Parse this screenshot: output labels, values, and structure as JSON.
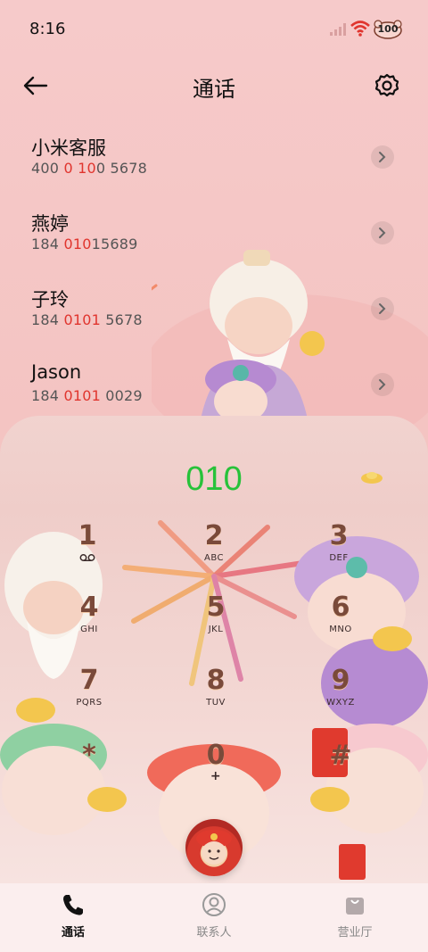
{
  "status": {
    "time": "8:16",
    "battery": "100",
    "icons": [
      "signal-icon",
      "wifi-icon",
      "battery-icon"
    ]
  },
  "header": {
    "title": "通话",
    "back_icon": "back-arrow-icon",
    "settings_icon": "gear-icon"
  },
  "recents": [
    {
      "name": "小米客服",
      "num_pre": "400 ",
      "num_hl": "0 10",
      "num_post": "0 5678"
    },
    {
      "name": "燕婷",
      "num_pre": "184 ",
      "num_hl": "010",
      "num_post": "15689"
    },
    {
      "name": "子玲",
      "num_pre": "184 ",
      "num_hl": "0101",
      "num_post": " 5678"
    },
    {
      "name": "Jason",
      "num_pre": "184 ",
      "num_hl": "0101",
      "num_post": " 0029"
    }
  ],
  "dialer": {
    "typed": "010",
    "keys": [
      {
        "digit": "1",
        "letters": "voicemail"
      },
      {
        "digit": "2",
        "letters": "ABC"
      },
      {
        "digit": "3",
        "letters": "DEF"
      },
      {
        "digit": "4",
        "letters": "GHI"
      },
      {
        "digit": "5",
        "letters": "JKL"
      },
      {
        "digit": "6",
        "letters": "MNO"
      },
      {
        "digit": "7",
        "letters": "PQRS"
      },
      {
        "digit": "8",
        "letters": "TUV"
      },
      {
        "digit": "9",
        "letters": "WXYZ"
      },
      {
        "digit": "*",
        "letters": ""
      },
      {
        "digit": "0",
        "letters": "+"
      },
      {
        "digit": "#",
        "letters": ""
      }
    ]
  },
  "nav": [
    {
      "label": "通话",
      "icon": "phone-icon",
      "active": true
    },
    {
      "label": "联系人",
      "icon": "contacts-icon",
      "active": false
    },
    {
      "label": "营业厅",
      "icon": "store-bag-icon",
      "active": false
    }
  ],
  "colors": {
    "accent_digits": "#27c23a",
    "highlight": "#e0352e",
    "background": "#f4c4c2"
  }
}
